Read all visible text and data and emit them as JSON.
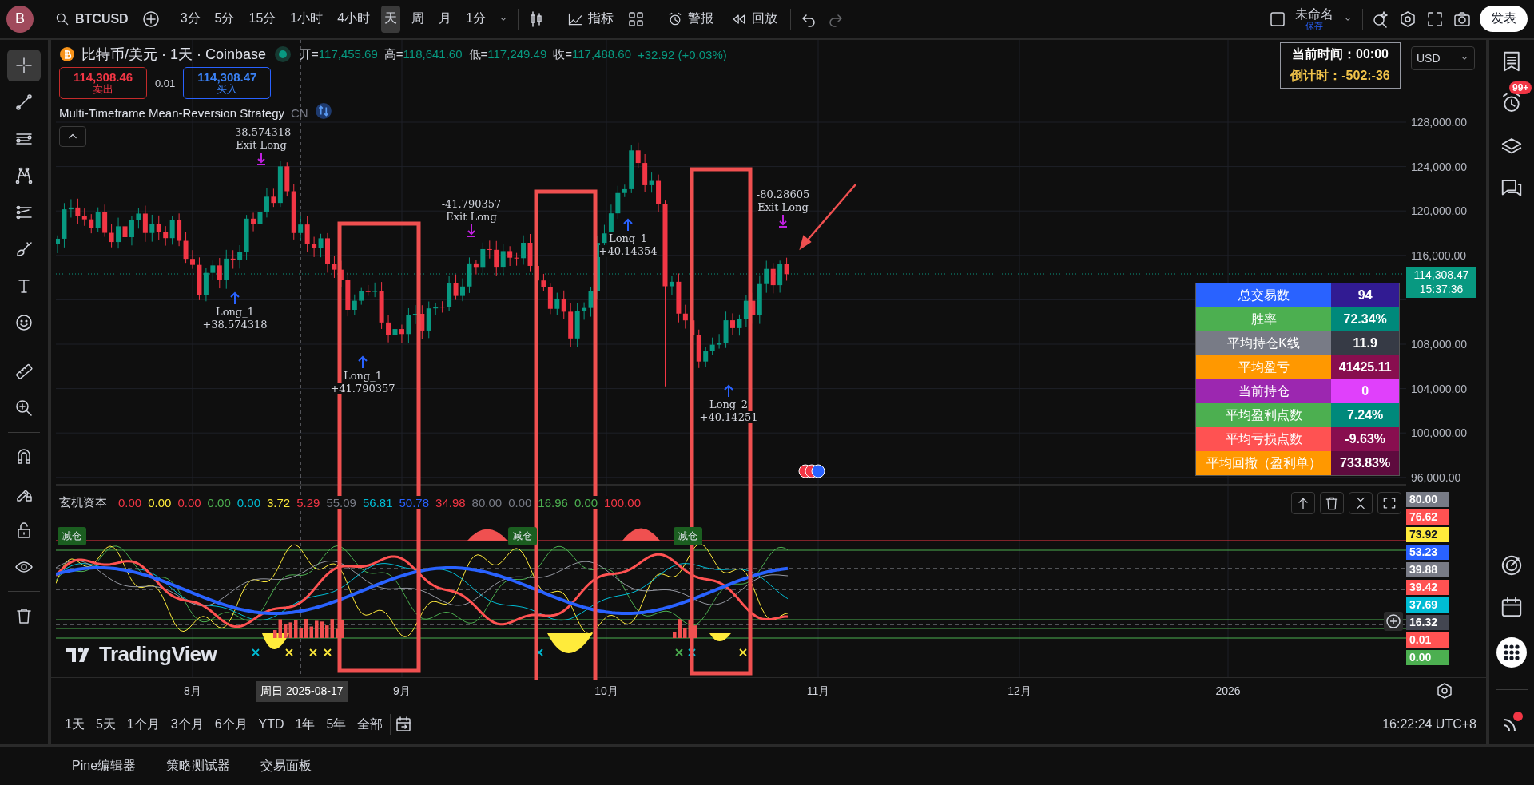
{
  "topbar": {
    "avatar": "B",
    "symbol": "BTCUSD",
    "intervals": [
      {
        "label": "3分",
        "selected": false
      },
      {
        "label": "5分",
        "selected": false
      },
      {
        "label": "15分",
        "selected": false
      },
      {
        "label": "1小时",
        "selected": false
      },
      {
        "label": "4小时",
        "selected": false
      },
      {
        "label": "天",
        "selected": true
      },
      {
        "label": "周",
        "selected": false
      },
      {
        "label": "月",
        "selected": false
      },
      {
        "label": "1分",
        "selected": false
      }
    ],
    "indicators": "指标",
    "alerts": "警报",
    "replay": "回放",
    "layout_name": "未命名",
    "save_status": "保存",
    "publish": "发表"
  },
  "left_toolbar": {
    "tools": [
      {
        "selected": true
      },
      {
        "selected": false
      },
      {
        "selected": false
      },
      {
        "selected": false
      },
      {
        "selected": false
      },
      {
        "selected": false
      },
      {
        "selected": false
      },
      {
        "selected": false
      },
      {
        "selected": false
      },
      {
        "selected": false
      },
      {
        "selected": false
      },
      {
        "selected": false
      },
      {
        "selected": false
      },
      {
        "selected": false
      },
      {
        "selected": false
      }
    ]
  },
  "legend": {
    "title": "比特币/美元 · 1天 · Coinbase",
    "ohlc": [
      {
        "label": "开=",
        "value": "117,455.69"
      },
      {
        "label": "高=",
        "value": "118,641.60"
      },
      {
        "label": "低=",
        "value": "117,249.49"
      },
      {
        "label": "收=",
        "value": "117,488.60"
      }
    ],
    "change": "+32.92 (+0.03%)",
    "sell": {
      "price": "114,308.46",
      "label": "卖出"
    },
    "spread": "0.01",
    "buy": {
      "price": "114,308.47",
      "label": "买入"
    },
    "strategy": {
      "name": "Multi-Timeframe Mean-Reversion Strategy",
      "tag": "CN"
    }
  },
  "clock_box": {
    "current_time": "当前时间：00:00",
    "countdown": "倒计时：-502:-36"
  },
  "currency": "USD",
  "price_axis": {
    "ticks_upper": [
      "128,000.00",
      "124,000.00",
      "120,000.00",
      "116,000.00"
    ],
    "ticks_lower": [
      "108,000.00",
      "104,000.00",
      "100,000.00",
      "96,000.00"
    ],
    "current_price": "114,308.47",
    "bar_countdown": "15:37:36"
  },
  "trade_labels": [
    {
      "kind": "exit",
      "name": "Exit Long",
      "amount": "-38.574318"
    },
    {
      "kind": "entry",
      "name": "Long_1",
      "amount": "+38.574318"
    },
    {
      "kind": "exit",
      "name": "Exit Long",
      "amount": "-41.790357"
    },
    {
      "kind": "entry",
      "name": "Long_1",
      "amount": "+41.790357"
    },
    {
      "kind": "entry",
      "name": "Long_1",
      "amount": "+40.14354"
    },
    {
      "kind": "exit",
      "name": "Exit Long",
      "amount": "-80.28605"
    },
    {
      "kind": "entry",
      "name": "Long_2",
      "amount": "+40.14251"
    }
  ],
  "stats_table": [
    {
      "label": {
        "text": "总交易数",
        "color": "#2962ff"
      },
      "value": {
        "text": "94",
        "color": "#311b92"
      }
    },
    {
      "label": {
        "text": "胜率",
        "color": "#4caf50"
      },
      "value": {
        "text": "72.34%",
        "color": "#00897b"
      }
    },
    {
      "label": {
        "text": "平均持仓K线",
        "color": "#787b86"
      },
      "value": {
        "text": "11.9",
        "color": "#363a45"
      }
    },
    {
      "label": {
        "text": "平均盈亏",
        "color": "#ff9800"
      },
      "value": {
        "text": "41425.11",
        "color": "#880e4f"
      }
    },
    {
      "label": {
        "text": "当前持仓",
        "color": "#9c27b0"
      },
      "value": {
        "text": "0",
        "color": "#e040fb"
      }
    },
    {
      "label": {
        "text": "平均盈利点数",
        "color": "#4caf50"
      },
      "value": {
        "text": "7.24%",
        "color": "#00897b"
      }
    },
    {
      "label": {
        "text": "平均亏损点数",
        "color": "#ff5252"
      },
      "value": {
        "text": "-9.63%",
        "color": "#880e4f"
      }
    },
    {
      "label": {
        "text": "平均回撤（盈利单）",
        "color": "#ff9800"
      },
      "value": {
        "text": "733.83%",
        "color": "#5e0b3e"
      }
    }
  ],
  "oscillator": {
    "name": "玄机资本",
    "values": [
      {
        "value": "0.00",
        "color": "#f23645"
      },
      {
        "value": "0.00",
        "color": "#ffeb3b"
      },
      {
        "value": "0.00",
        "color": "#f23645"
      },
      {
        "value": "0.00",
        "color": "#4caf50"
      },
      {
        "value": "0.00",
        "color": "#00bcd4"
      },
      {
        "value": "3.72",
        "color": "#ffeb3b"
      },
      {
        "value": "5.29",
        "color": "#f23645"
      },
      {
        "value": "55.09",
        "color": "#787b86"
      },
      {
        "value": "56.81",
        "color": "#00bcd4"
      },
      {
        "value": "50.78",
        "color": "#2962ff"
      },
      {
        "value": "34.98",
        "color": "#f23645"
      },
      {
        "value": "80.00",
        "color": "#787b86"
      },
      {
        "value": "0.00",
        "color": "#787b86"
      },
      {
        "value": "16.96",
        "color": "#4caf50"
      },
      {
        "value": "0.00",
        "color": "#4caf50"
      },
      {
        "value": "100.00",
        "color": "#f23645"
      }
    ],
    "badges": [
      "减仓",
      "减仓",
      "减仓"
    ],
    "axis_labels": [
      {
        "value": "80.00",
        "color": "#787b86"
      },
      {
        "value": "76.62",
        "color": "#ff5252"
      },
      {
        "value": "73.92",
        "color": "#ffeb3b"
      },
      {
        "value": "53.23",
        "color": "#2962ff"
      },
      {
        "value": "39.88",
        "color": "#787b86"
      },
      {
        "value": "39.42",
        "color": "#ff5252"
      },
      {
        "value": "37.69",
        "color": "#00bcd4"
      },
      {
        "value": "16.32",
        "color": "#434651"
      },
      {
        "value": "0.01",
        "color": "#ff5252"
      },
      {
        "value": "0.00",
        "color": "#4caf50"
      }
    ],
    "watermark_logo": "TradingView"
  },
  "time_axis": {
    "labels": [
      "8月",
      "9月",
      "10月",
      "11月",
      "12月",
      "2026"
    ],
    "crosshair_label": "周日 2025-08-17"
  },
  "range_bar": {
    "ranges": [
      "1天",
      "5天",
      "1个月",
      "3个月",
      "6个月",
      "YTD",
      "1年",
      "5年",
      "全部"
    ],
    "clock": "16:22:24 UTC+8"
  },
  "bottom_tabs": [
    "Pine编辑器",
    "策略测试器",
    "交易面板"
  ],
  "right_sidebar": {
    "alert_badge": "99+"
  }
}
